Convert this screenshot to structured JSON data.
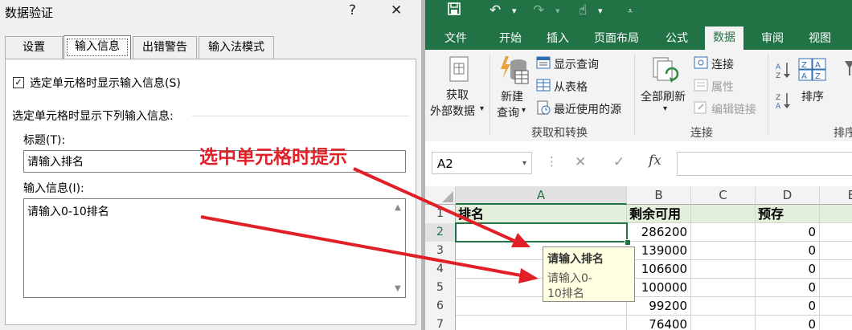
{
  "dialog": {
    "title": "数据验证",
    "help_label": "?",
    "close_label": "✕",
    "tabs": [
      "设置",
      "输入信息",
      "出错警告",
      "输入法模式"
    ],
    "show_input_checkbox": {
      "checked": true,
      "label": "选定单元格时显示输入信息(S)"
    },
    "section_label": "选定单元格时显示下列输入信息:",
    "title_label": "标题(T):",
    "title_value": "请输入排名",
    "message_label": "输入信息(I):",
    "message_value": "请输入0-10排名"
  },
  "excel": {
    "quick_access": {
      "save": "save-icon",
      "undo": "undo-icon",
      "redo": "redo-icon",
      "touch": "touch-mode-icon",
      "customize": "customize-icon"
    },
    "ribbon_tabs": [
      "文件",
      "开始",
      "插入",
      "页面布局",
      "公式",
      "数据",
      "审阅",
      "视图"
    ],
    "active_tab": "数据",
    "get_transform": {
      "get_external_line1": "获取",
      "get_external_line2": "外部数据",
      "new_query_line1": "新建",
      "new_query_line2": "查询",
      "show_queries": "显示查询",
      "from_table": "从表格",
      "recent_sources": "最近使用的源",
      "group_label": "获取和转换"
    },
    "connections": {
      "refresh_all_line1": "全部刷新",
      "connections": "连接",
      "properties": "属性",
      "edit_links": "编辑链接",
      "group_label": "连接"
    },
    "sort_filter": {
      "sort": "排序",
      "group_label_partial": "排序"
    },
    "name_box": "A2",
    "formula_icons": {
      "cancel": "✕",
      "enter": "✓",
      "fx": "fx"
    },
    "formula_value": "",
    "columns": [
      "A",
      "B",
      "C",
      "D",
      "E"
    ],
    "rows": [
      {
        "num": "1",
        "A": "排名",
        "B": "剩余可用",
        "C": "",
        "D": "预存"
      },
      {
        "num": "2",
        "A": "",
        "B": "286200",
        "C": "",
        "D": "0"
      },
      {
        "num": "3",
        "A": "",
        "B": "139000",
        "C": "",
        "D": "0"
      },
      {
        "num": "4",
        "A": "",
        "B": "106600",
        "C": "",
        "D": "0"
      },
      {
        "num": "5",
        "A": "",
        "B": "100000",
        "C": "",
        "D": "0"
      },
      {
        "num": "6",
        "A": "",
        "B": "99200",
        "C": "",
        "D": "0"
      },
      {
        "num": "7",
        "A": "",
        "B": "76400",
        "C": "",
        "D": "0"
      }
    ],
    "input_tip": {
      "title": "请输入排名",
      "line1": "请输入0-",
      "line2": "10排名"
    }
  },
  "annotation": {
    "text": "选中单元格时提示",
    "color": "#e11f26"
  },
  "colors": {
    "excel_green": "#217346",
    "tip_bg": "#ffffe1"
  }
}
